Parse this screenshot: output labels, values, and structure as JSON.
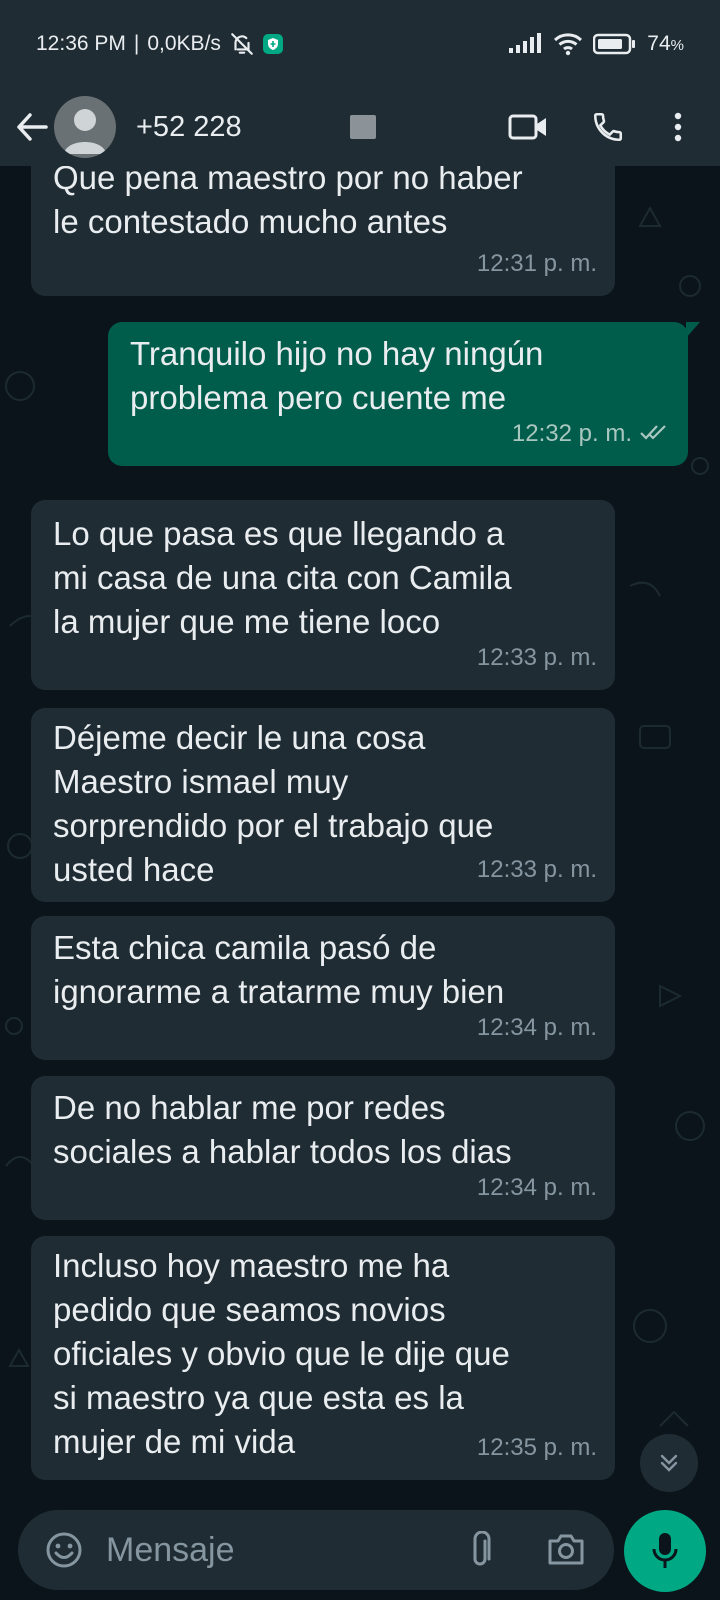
{
  "status_bar": {
    "time": "12:36 PM",
    "network_speed": "0,0KB/s",
    "battery": "74",
    "battery_unit": "%",
    "icons": [
      "bell-off-icon",
      "shield-icon",
      "signal-icon",
      "wifi-icon",
      "battery-icon"
    ]
  },
  "header": {
    "contact": "+52 228",
    "icons": [
      "back-arrow-icon",
      "avatar-icon",
      "video-call-icon",
      "phone-icon",
      "more-vert-icon"
    ]
  },
  "messages": [
    {
      "direction": "in",
      "text": "Que pena maestro por no haber\nle contestado mucho antes",
      "time": "12:31 p. m."
    },
    {
      "direction": "out",
      "text": "Tranquilo hijo no hay ningún\nproblema pero cuente me",
      "time": "12:32 p. m.",
      "status": "read"
    },
    {
      "direction": "in",
      "text": "Lo que pasa es que llegando a\nmi casa de una cita con Camila\nla mujer que me tiene loco",
      "time": "12:33 p. m."
    },
    {
      "direction": "in",
      "text": "Déjeme decir le una cosa\nMaestro ismael muy\nsorprendido por el trabajo que\nusted hace",
      "time": "12:33 p. m."
    },
    {
      "direction": "in",
      "text": "Esta chica camila pasó de\nignorarme a tratarme muy bien",
      "time": "12:34 p. m."
    },
    {
      "direction": "in",
      "text": "De no hablar me por redes\nsociales a hablar todos los dias",
      "time": "12:34 p. m."
    },
    {
      "direction": "in",
      "text": "Incluso hoy maestro me ha\npedido que seamos novios\noficiales y obvio que le dije que\nsi maestro ya que esta es la\nmujer de mi vida",
      "time": "12:35 p. m."
    }
  ],
  "input": {
    "placeholder": "Mensaje",
    "icons": [
      "emoji-icon",
      "attach-icon",
      "camera-icon",
      "mic-icon",
      "scroll-down-icon"
    ]
  },
  "colors": {
    "background": "#0b141a",
    "incoming_bubble": "#1f2c34",
    "outgoing_bubble": "#005c4b",
    "accent": "#00a884",
    "meta_text": "#8696a0"
  }
}
